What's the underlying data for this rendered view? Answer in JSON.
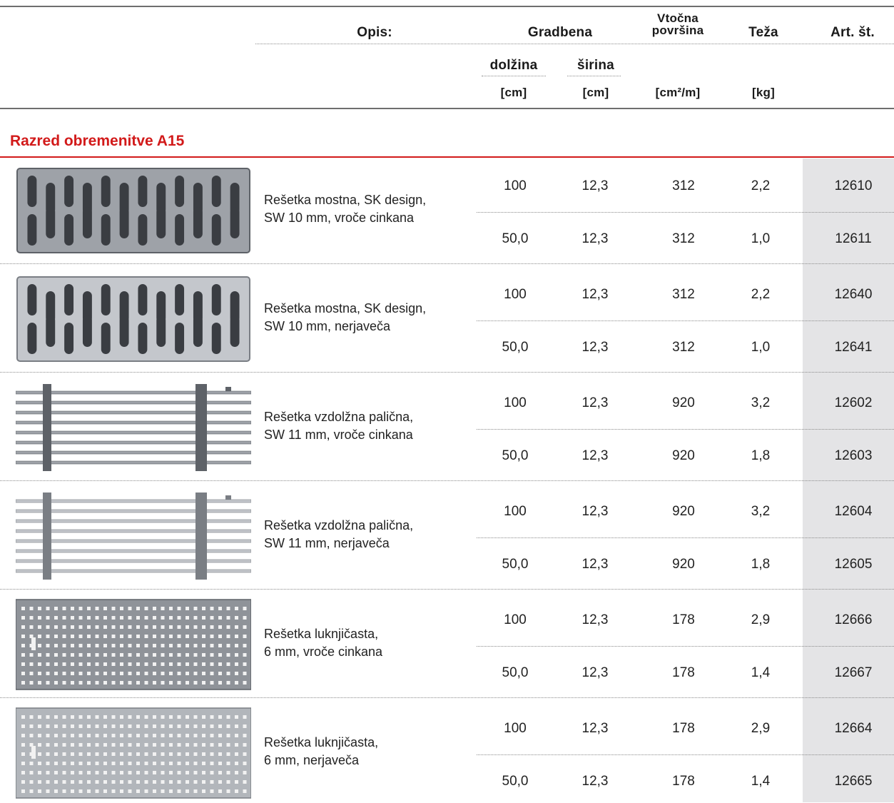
{
  "header": {
    "opis": "Opis:",
    "gradbena": "Gradbena",
    "vtocna_1": "Vtočna",
    "vtocna_2": "površina",
    "teza": "Teža",
    "art": "Art. št.",
    "dolzina": "dolžina",
    "sirina": "širina",
    "unit_cm1": "[cm]",
    "unit_cm2": "[cm]",
    "unit_cm2m": "[cm²/m]",
    "unit_kg": "[kg]"
  },
  "section": {
    "title": "Razred obremenitve A15"
  },
  "products": [
    {
      "image": "bridge-grate-galvanized",
      "desc1": "Rešetka mostna, SK design,",
      "desc2": "SW 10 mm, vroče cinkana",
      "rows": [
        {
          "dolzina": "100",
          "sirina": "12,3",
          "povrsina": "312",
          "teza": "2,2",
          "art": "12610"
        },
        {
          "dolzina": "50,0",
          "sirina": "12,3",
          "povrsina": "312",
          "teza": "1,0",
          "art": "12611"
        }
      ]
    },
    {
      "image": "bridge-grate-stainless",
      "desc1": "Rešetka mostna, SK design,",
      "desc2": "SW 10 mm, nerjaveča",
      "rows": [
        {
          "dolzina": "100",
          "sirina": "12,3",
          "povrsina": "312",
          "teza": "2,2",
          "art": "12640"
        },
        {
          "dolzina": "50,0",
          "sirina": "12,3",
          "povrsina": "312",
          "teza": "1,0",
          "art": "12641"
        }
      ]
    },
    {
      "image": "longitudinal-bar-grate-galvanized",
      "desc1": "Rešetka vzdolžna palična,",
      "desc2": "SW 11 mm, vroče cinkana",
      "rows": [
        {
          "dolzina": "100",
          "sirina": "12,3",
          "povrsina": "920",
          "teza": "3,2",
          "art": "12602"
        },
        {
          "dolzina": "50,0",
          "sirina": "12,3",
          "povrsina": "920",
          "teza": "1,8",
          "art": "12603"
        }
      ]
    },
    {
      "image": "longitudinal-bar-grate-stainless",
      "desc1": "Rešetka vzdolžna palična,",
      "desc2": "SW 11 mm, nerjaveča",
      "rows": [
        {
          "dolzina": "100",
          "sirina": "12,3",
          "povrsina": "920",
          "teza": "3,2",
          "art": "12604"
        },
        {
          "dolzina": "50,0",
          "sirina": "12,3",
          "povrsina": "920",
          "teza": "1,8",
          "art": "12605"
        }
      ]
    },
    {
      "image": "perforated-grate-galvanized",
      "desc1": "Rešetka luknjičasta,",
      "desc2": "6 mm, vroče cinkana",
      "rows": [
        {
          "dolzina": "100",
          "sirina": "12,3",
          "povrsina": "178",
          "teza": "2,9",
          "art": "12666"
        },
        {
          "dolzina": "50,0",
          "sirina": "12,3",
          "povrsina": "178",
          "teza": "1,4",
          "art": "12667"
        }
      ]
    },
    {
      "image": "perforated-grate-stainless",
      "desc1": "Rešetka luknjičasta,",
      "desc2": "6 mm, nerjaveča",
      "rows": [
        {
          "dolzina": "100",
          "sirina": "12,3",
          "povrsina": "178",
          "teza": "2,9",
          "art": "12664"
        },
        {
          "dolzina": "50,0",
          "sirina": "12,3",
          "povrsina": "178",
          "teza": "1,4",
          "art": "12665"
        }
      ]
    }
  ],
  "colors": {
    "accent_red": "#d21a1a",
    "art_column_bg": "#e4e4e6",
    "rule_gray": "#6e6e6e"
  }
}
